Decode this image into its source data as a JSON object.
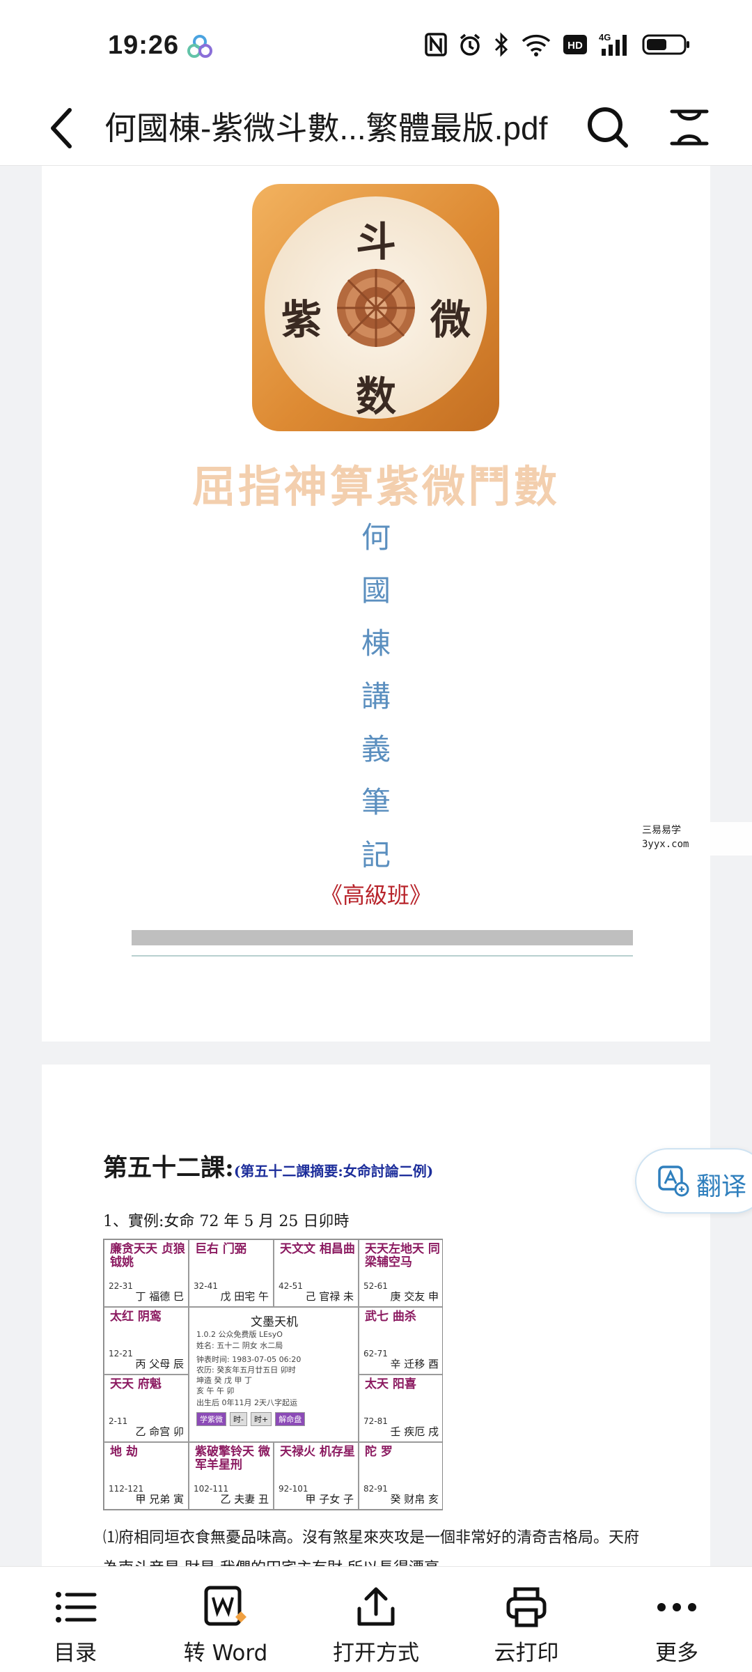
{
  "status_bar": {
    "time": "19:26",
    "icons": [
      "nfc-icon",
      "alarm-icon",
      "bluetooth-icon",
      "wifi-icon",
      "hd-icon",
      "signal-4g-icon",
      "battery-icon"
    ],
    "hd_label": "HD",
    "network_label": "4G"
  },
  "header": {
    "title": "何國棟-紫微斗數...繁體最版.pdf"
  },
  "page1": {
    "logo_chars": {
      "top": "斗",
      "left": "紫",
      "right": "微",
      "bottom": "数"
    },
    "main_title": "屈指神算紫微鬥數",
    "vertical_title": [
      "何",
      "國",
      "棟",
      "講",
      "義",
      "筆",
      "記"
    ],
    "sub_title": "《高級班》",
    "watermark": {
      "line1": "三易易学",
      "line2": "3yyx.com"
    }
  },
  "page2": {
    "lesson_title": "第五十二課:",
    "lesson_summary": "(第五十二課摘要:女命討論二例)",
    "example_line": "1、實例:女命 72 年 5 月 25 日卯時",
    "chart": {
      "center_title": "文墨天机",
      "center_lines": [
        "1.0.2 公众免费版 LEsyO",
        "姓名: 五十二    阴女 水二局",
        "钟表时间: 1983-07-05 06:20",
        "农历: 癸亥年五月廿五日 卯时",
        "坤造  癸   戊   甲   丁",
        "      亥   午   午   卯",
        "出生后 0年11月 2天八字起运"
      ],
      "center_buttons": [
        "学紫微",
        "时-",
        "时+",
        "解命盘"
      ],
      "cells": [
        {
          "stars": "廉贪天天 贞狼钺姚",
          "palace": "丁 福德 巳",
          "range": "22-31"
        },
        {
          "stars": "巨右 门弼",
          "palace": "戊 田宅 午",
          "range": "32-41"
        },
        {
          "stars": "天文文 相昌曲",
          "palace": "己 官禄 未",
          "range": "42-51"
        },
        {
          "stars": "天天左地天 同梁辅空马",
          "palace": "庚 交友 申",
          "range": "52-61"
        },
        {
          "stars": "太红 阴鸾",
          "palace": "丙 父母 辰",
          "range": "12-21"
        },
        {
          "stars": "武七 曲杀",
          "palace": "辛 迁移 酉",
          "range": "62-71"
        },
        {
          "stars": "天天 府魁",
          "palace": "乙 命宫 卯",
          "range": "2-11"
        },
        {
          "stars": "太天 阳喜",
          "palace": "壬 疾厄 戌",
          "range": "72-81"
        },
        {
          "stars": "地 劫",
          "palace": "甲 兄弟 寅",
          "range": "112-121"
        },
        {
          "stars": "紫破擎铃天 微军羊星刑",
          "palace": "乙 夫妻 丑",
          "range": "102-111"
        },
        {
          "stars": "天禄火 机存星",
          "palace": "甲 子女 子",
          "range": "92-101"
        },
        {
          "stars": "陀 罗",
          "palace": "癸 财帛 亥",
          "range": "82-91"
        }
      ]
    },
    "body_text_1": "⑴府相同垣衣食無憂品味高。沒有煞星來夾攻是一個非常好的清奇吉格局。天府",
    "body_text_2": "為南斗帝星,財星,我們的田宅主有財,所以長得漂亮"
  },
  "translate_button": {
    "label": "翻译"
  },
  "bottom_bar": {
    "items": [
      {
        "label": "目录",
        "icon": "list-icon"
      },
      {
        "label": "转 Word",
        "icon": "convert-word-icon"
      },
      {
        "label": "打开方式",
        "icon": "share-icon"
      },
      {
        "label": "云打印",
        "icon": "print-icon"
      },
      {
        "label": "更多",
        "icon": "more-icon"
      }
    ]
  },
  "colors": {
    "main_title": "#f3cfae",
    "vertical_title": "#5b8fbf",
    "sub_title": "#b8242b",
    "summary": "#1d2e9b",
    "translate_accent": "#2f7fbd",
    "logo_orange": "#dd8a33"
  }
}
